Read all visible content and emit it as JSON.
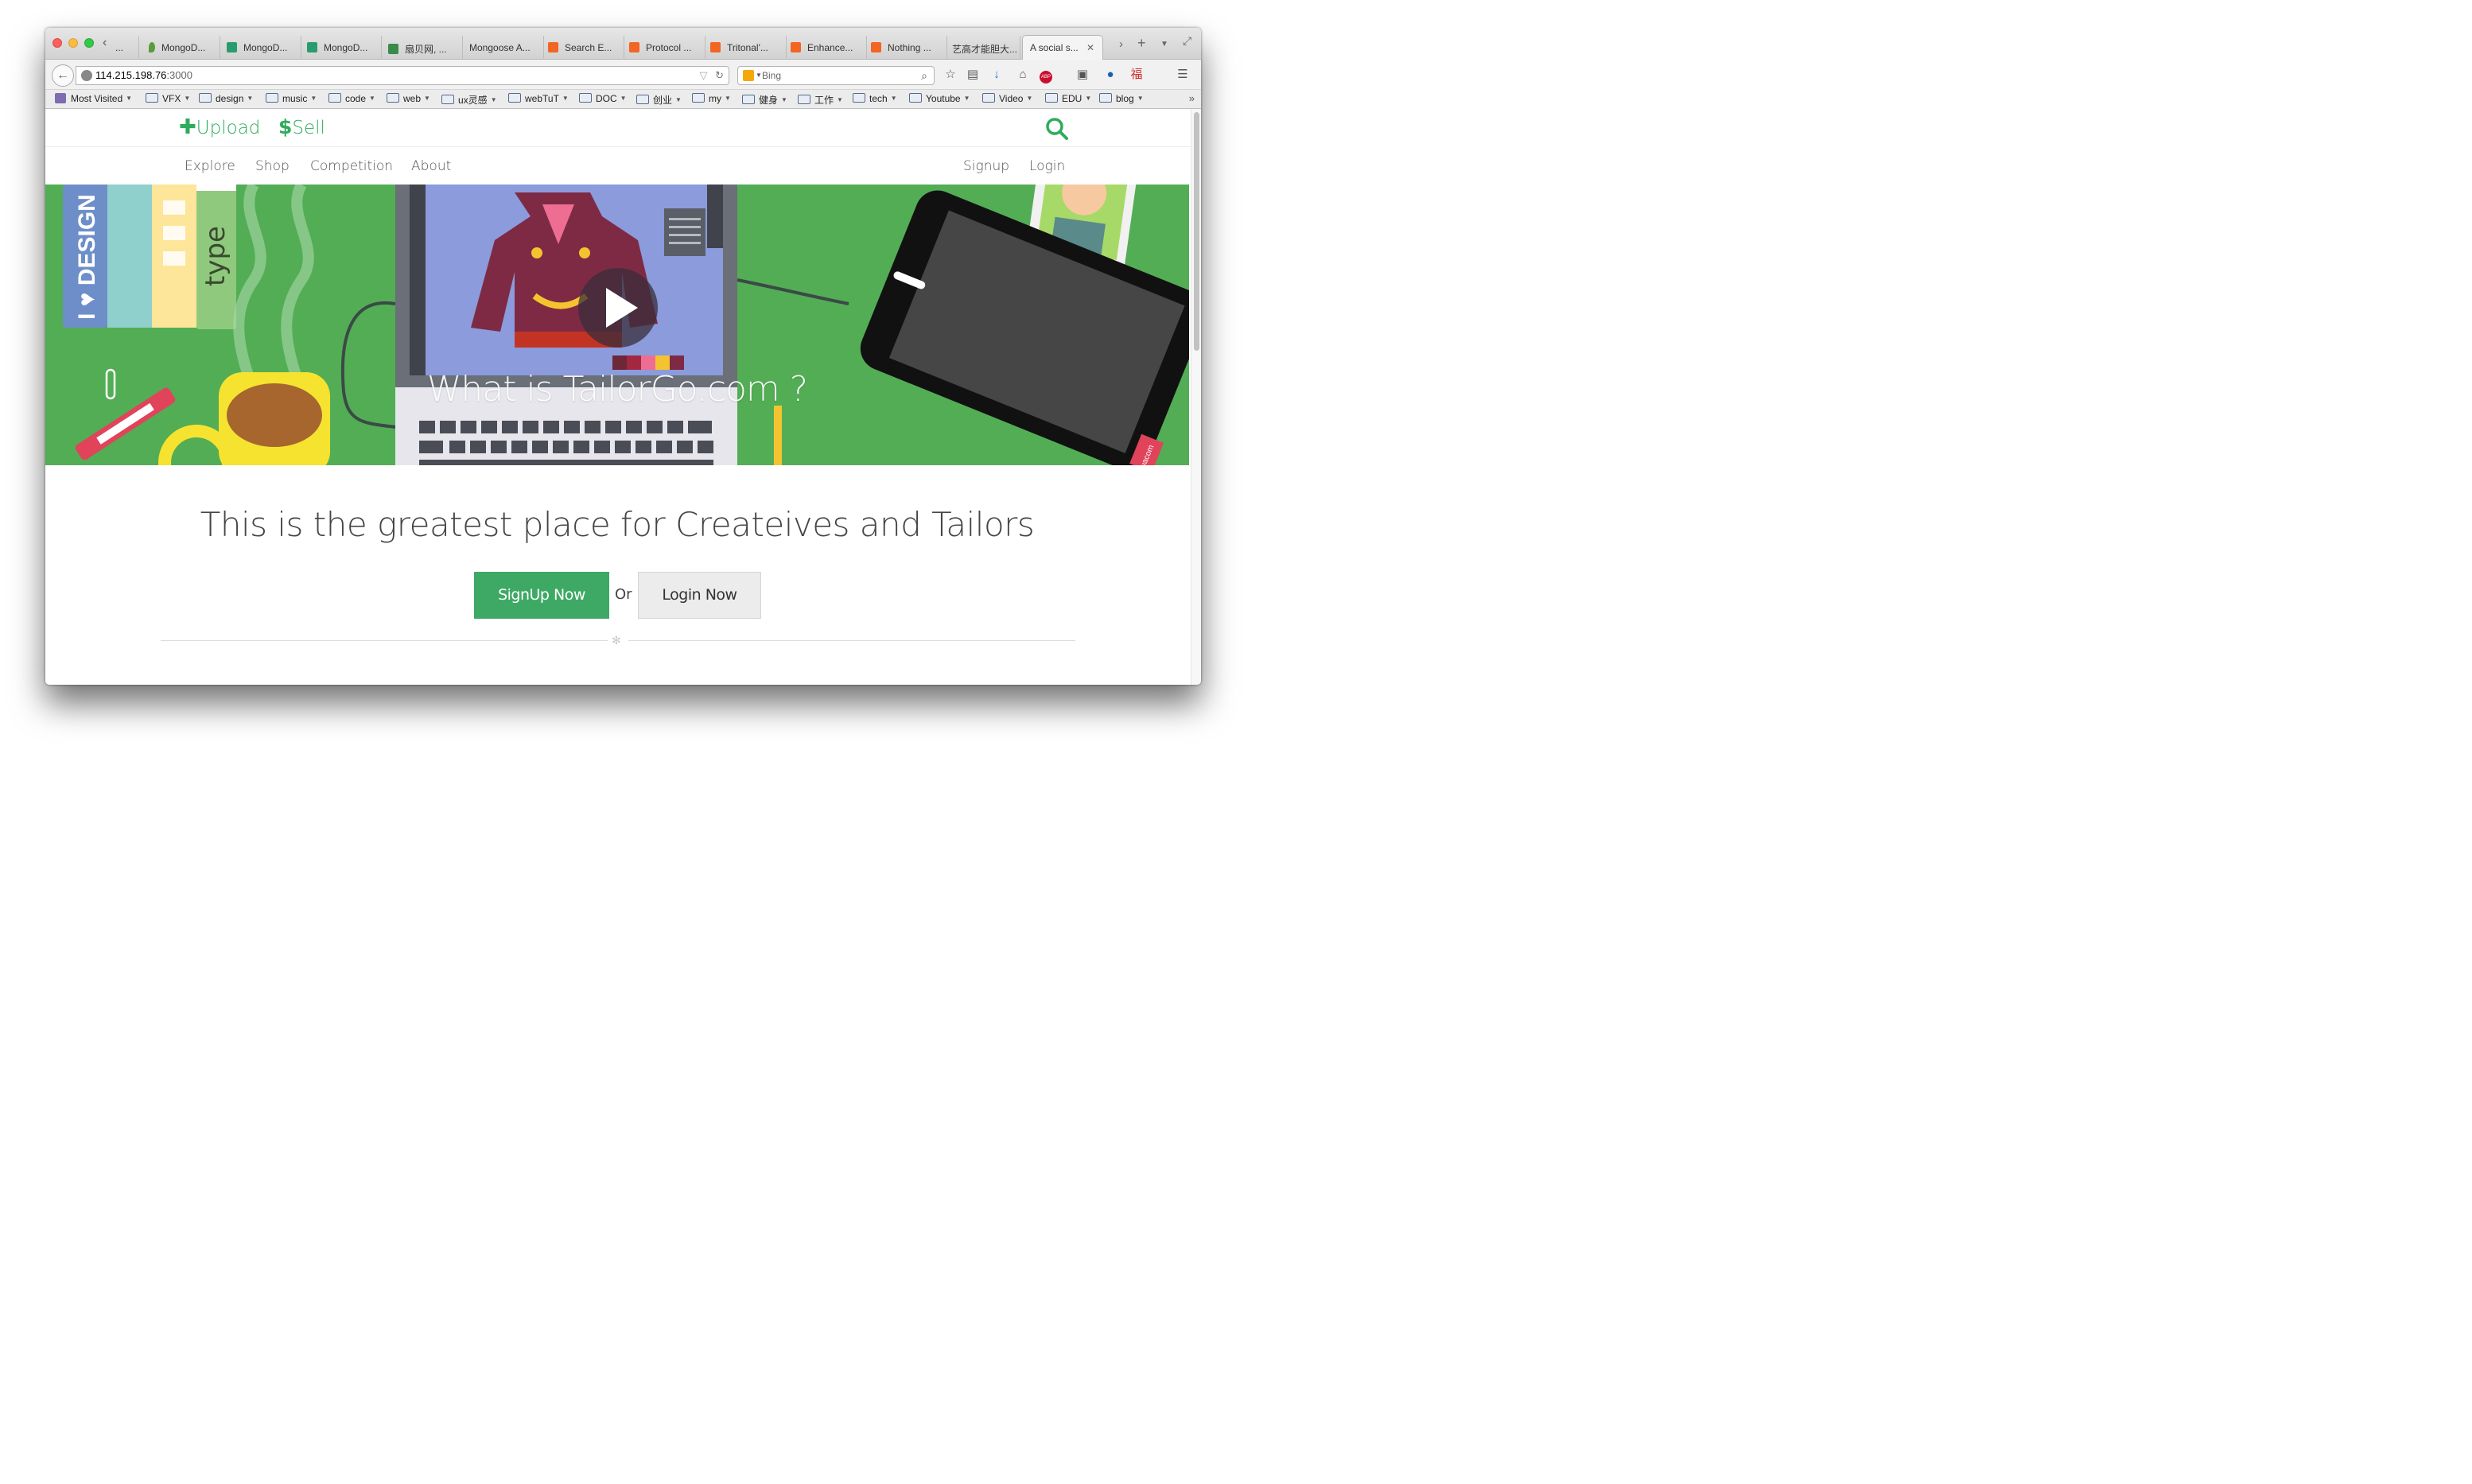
{
  "browser": {
    "tabs": [
      {
        "label": "...",
        "favicon_color": "#999999"
      },
      {
        "label": "MongoD...",
        "favicon_color": "#5a9b3c"
      },
      {
        "label": "MongoD...",
        "favicon_color": "#2a9b6e"
      },
      {
        "label": "MongoD...",
        "favicon_color": "#2a9b6e"
      },
      {
        "label": "扇贝网,  ...",
        "favicon_color": "#3a8a4a"
      },
      {
        "label": "Mongoose A...",
        "favicon_color": "#dddddd"
      },
      {
        "label": "Search E...",
        "favicon_color": "#f26522"
      },
      {
        "label": "Protocol ...",
        "favicon_color": "#f26522"
      },
      {
        "label": "Tritonal'...",
        "favicon_color": "#f26522"
      },
      {
        "label": "Enhance...",
        "favicon_color": "#f26522"
      },
      {
        "label": "Nothing ...",
        "favicon_color": "#f26522"
      },
      {
        "label": "艺高才能胆大...",
        "favicon_color": "#dddddd"
      },
      {
        "label": "A social s...",
        "favicon_color": "#dddddd",
        "active": true
      }
    ],
    "url_host": "114.215.198.76",
    "url_port": ":3000",
    "search_placeholder": "Bing",
    "bookmarks": [
      {
        "label": "Most Visited"
      },
      {
        "label": "VFX"
      },
      {
        "label": "design"
      },
      {
        "label": "music"
      },
      {
        "label": "code"
      },
      {
        "label": "web"
      },
      {
        "label": "ux灵感"
      },
      {
        "label": "webTuT"
      },
      {
        "label": "DOC"
      },
      {
        "label": "创业"
      },
      {
        "label": "my"
      },
      {
        "label": "健身"
      },
      {
        "label": "工作"
      },
      {
        "label": "tech"
      },
      {
        "label": "Youtube"
      },
      {
        "label": "Video"
      },
      {
        "label": "EDU"
      },
      {
        "label": "blog"
      }
    ]
  },
  "site": {
    "top": {
      "upload_label": "Upload",
      "sell_label": "Sell"
    },
    "nav": {
      "explore": "Explore",
      "shop": "Shop",
      "competition": "Competition",
      "about": "About",
      "signup": "Signup",
      "login": "Login"
    },
    "hero": {
      "title": "What is TailorGo.com ?",
      "book_text_1": "I ♥ DESIGN",
      "book_text_2": "type",
      "tablet_brand": "wacom"
    },
    "tagline": "This is the greatest place for Createives and Tailors",
    "cta": {
      "signup_label": "SignUp Now",
      "or_label": "Or",
      "login_label": "Login Now"
    }
  },
  "colors": {
    "brand_green": "#2eab5c",
    "hero_bg": "#53ad55",
    "signup_button": "#3ea964"
  }
}
